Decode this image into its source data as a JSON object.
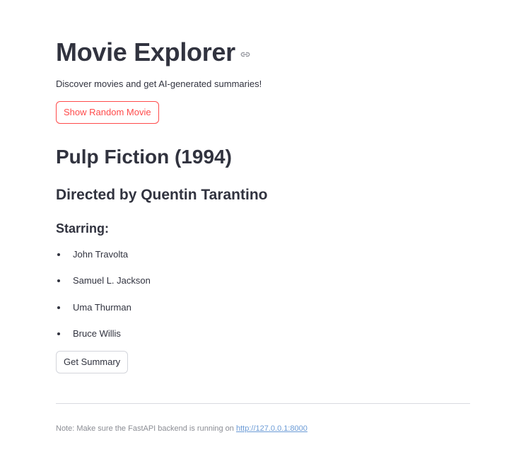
{
  "header": {
    "title": "Movie Explorer",
    "subtitle": "Discover movies and get AI-generated summaries!"
  },
  "actions": {
    "random_label": "Show Random Movie",
    "summary_label": "Get Summary"
  },
  "movie": {
    "title": "Pulp Fiction (1994)",
    "director": "Directed by Quentin Tarantino",
    "starring_heading": "Starring:",
    "cast": [
      "John Travolta",
      "Samuel L. Jackson",
      "Uma Thurman",
      "Bruce Willis"
    ]
  },
  "footer": {
    "note_prefix": "Note: Make sure the FastAPI backend is running on ",
    "link_text": "http://127.0.0.1:8000"
  },
  "colors": {
    "primary": "#ff4b4b",
    "text": "#31333f",
    "muted": "#8b8d94",
    "link": "#6b9bd6",
    "divider": "#d9dbe0"
  },
  "icons": {
    "anchor": "link-icon"
  }
}
